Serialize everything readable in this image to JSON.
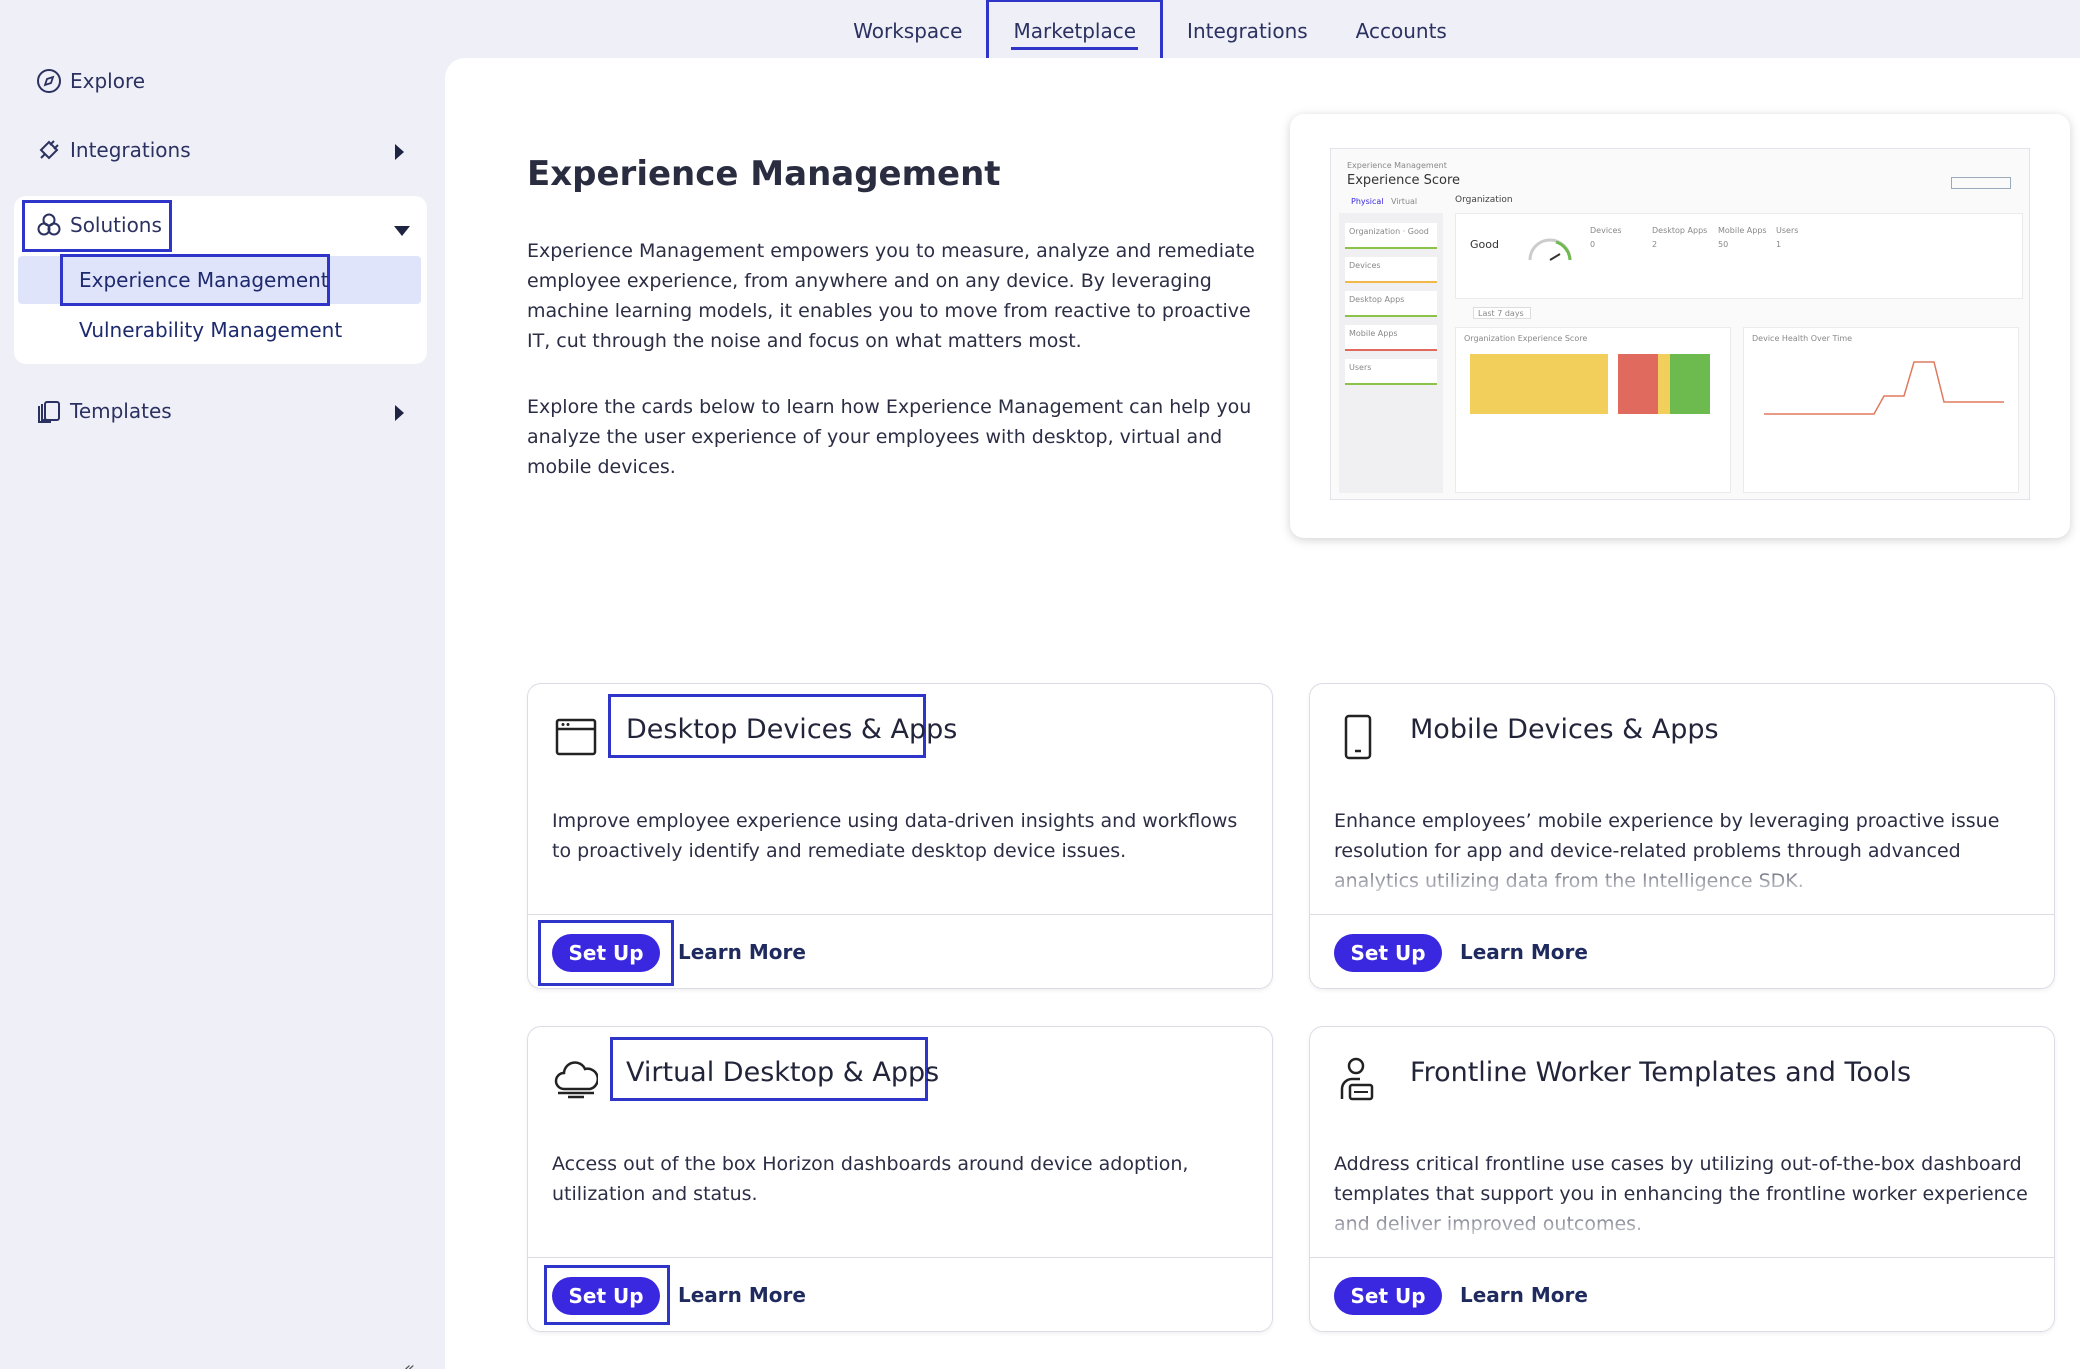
{
  "topnav": {
    "tabs": [
      {
        "label": "Workspace"
      },
      {
        "label": "Marketplace"
      },
      {
        "label": "Integrations"
      },
      {
        "label": "Accounts"
      }
    ]
  },
  "sidebar": {
    "explore": "Explore",
    "integrations": "Integrations",
    "solutions": "Solutions",
    "solution_items": [
      "Experience Management",
      "Vulnerability Management"
    ],
    "templates": "Templates"
  },
  "main": {
    "title": "Experience Management",
    "desc1": "Experience Management empowers you to measure, analyze and remediate employee experience, from anywhere and on any device. By leveraging machine learning models, it enables you to move from reactive to proactive IT, cut through the noise and focus on what matters most.",
    "desc2": "Explore the cards below to learn how Experience Management can help you analyze the user experience of your employees with desktop, virtual and mobile devices."
  },
  "preview": {
    "breadcrumb": "Experience Management",
    "title": "Experience Score",
    "tabs": [
      "Physical",
      "Virtual"
    ],
    "org_label": "Organization",
    "good": "Good",
    "metrics": [
      "Devices",
      "Desktop Apps",
      "Mobile Apps",
      "Users"
    ],
    "metric_values": [
      "0",
      "2",
      "50",
      "1"
    ],
    "filter": "Last 7 days",
    "chart1_title": "Organization Experience Score",
    "chart2_title": "Device Health Over Time",
    "left_rows": [
      "Organization · Good",
      "Devices",
      "Desktop Apps",
      "Mobile Apps",
      "Users"
    ],
    "colors": {
      "yellow": "#f2cf5b",
      "red": "#e06a5e",
      "green": "#6dbb4f",
      "line": "#e07a5f"
    }
  },
  "cards": [
    {
      "title": "Desktop Devices & Apps",
      "icon": "desktop-window-icon",
      "desc": "Improve employee experience using data-driven insights and workflows to proactively identify and remediate desktop device issues.",
      "setup": "Set Up",
      "learn": "Learn More"
    },
    {
      "title": "Mobile Devices & Apps",
      "icon": "mobile-phone-icon",
      "desc": "Enhance employees’ mobile experience by leveraging proactive issue resolution for app and device-related problems through advanced analytics utilizing data from the Intelligence SDK.",
      "setup": "Set Up",
      "learn": "Learn More"
    },
    {
      "title": "Virtual Desktop & Apps",
      "icon": "cloud-desktop-icon",
      "desc": "Access out of the box Horizon dashboards around device adoption, utilization and status.",
      "setup": "Set Up",
      "learn": "Learn More"
    },
    {
      "title": "Frontline Worker Templates and Tools",
      "icon": "frontline-worker-icon",
      "desc": "Address critical frontline use cases by utilizing out-of-the-box dashboard templates that support you in enhancing the frontline worker experience and deliver improved outcomes.",
      "setup": "Set Up",
      "learn": "Learn More"
    }
  ],
  "colors": {
    "accent": "#3a28e0",
    "highlight": "#2e35c8",
    "active_bg": "#e0e4fb"
  }
}
